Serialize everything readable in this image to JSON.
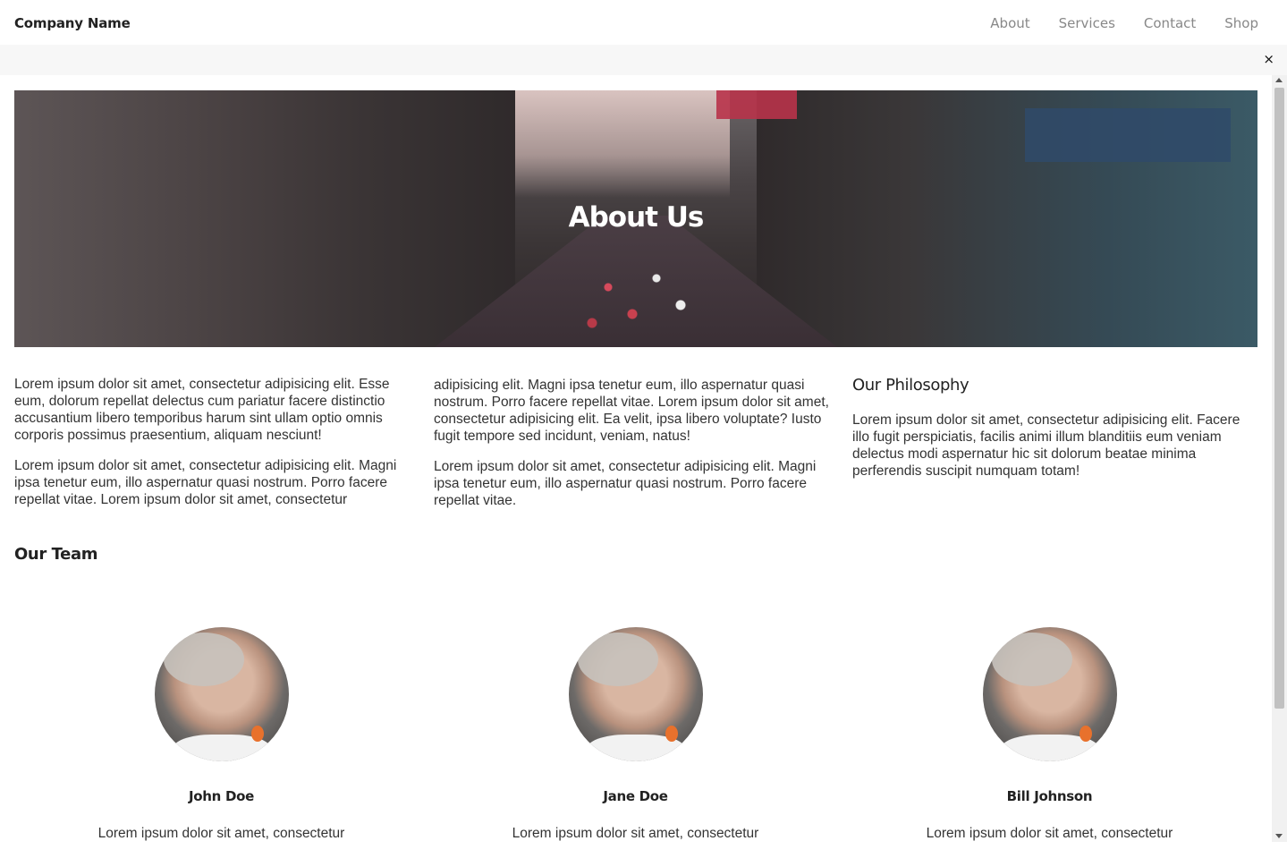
{
  "header": {
    "brand": "Company Name",
    "nav": [
      "About",
      "Services",
      "Contact",
      "Shop"
    ]
  },
  "notice": {
    "close_glyph": "×"
  },
  "hero": {
    "title": "About Us"
  },
  "content": {
    "col1": [
      "Lorem ipsum dolor sit amet, consectetur adipisicing elit. Esse eum, dolorum repellat delectus cum pariatur facere distinctio accusantium libero temporibus harum sint ullam optio omnis corporis possimus praesentium, aliquam nesciunt!",
      "Lorem ipsum dolor sit amet, consectetur adipisicing elit. Magni ipsa tenetur eum, illo aspernatur quasi nostrum. Porro facere repellat vitae. Lorem ipsum dolor sit amet, consectetur"
    ],
    "col2": [
      "adipisicing elit. Magni ipsa tenetur eum, illo aspernatur quasi nostrum. Porro facere repellat vitae. Lorem ipsum dolor sit amet, consectetur adipisicing elit. Ea velit, ipsa libero voluptate? Iusto fugit tempore sed incidunt, veniam, natus!",
      "Lorem ipsum dolor sit amet, consectetur adipisicing elit. Magni ipsa tenetur eum, illo aspernatur quasi nostrum. Porro facere repellat vitae."
    ],
    "philosophy": {
      "heading": "Our Philosophy",
      "text": "Lorem ipsum dolor sit amet, consectetur adipisicing elit. Facere illo fugit perspiciatis, facilis animi illum blanditiis eum veniam delectus modi aspernatur hic sit dolorum beatae minima perferendis suscipit numquam totam!"
    }
  },
  "team": {
    "heading": "Our Team",
    "members": [
      {
        "name": "John Doe",
        "bio": "Lorem ipsum dolor sit amet, consectetur"
      },
      {
        "name": "Jane Doe",
        "bio": "Lorem ipsum dolor sit amet, consectetur"
      },
      {
        "name": "Bill Johnson",
        "bio": "Lorem ipsum dolor sit amet, consectetur"
      }
    ]
  }
}
